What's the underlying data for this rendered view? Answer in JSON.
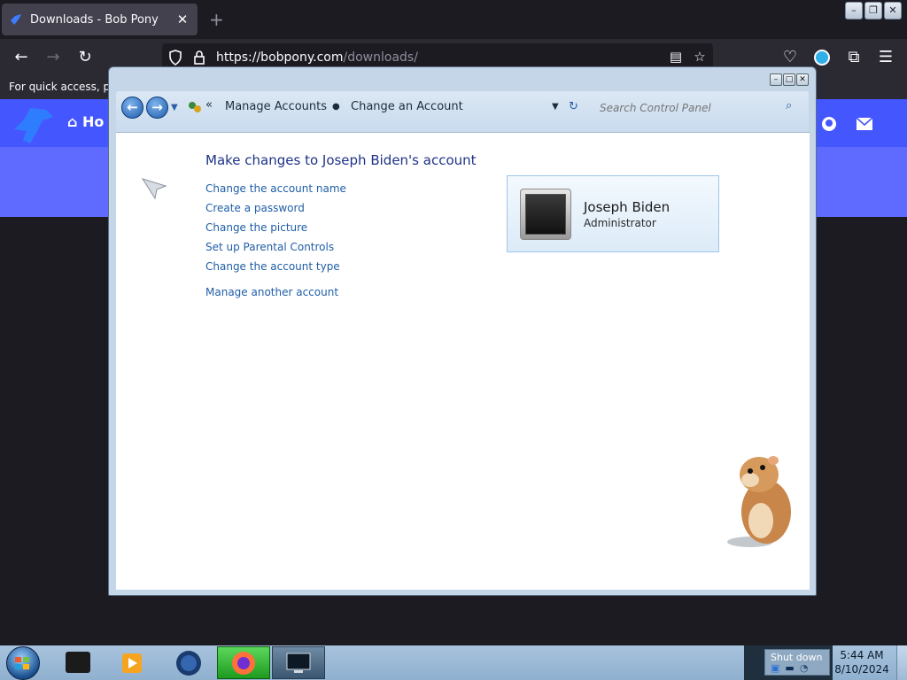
{
  "browser": {
    "tab_title": "Downloads - Bob Pony",
    "tab_close": "✕",
    "new_tab": "+",
    "url_host": "https://bobpony.com",
    "url_path": "/downloads/",
    "bookmarks_hint": "For quick access, plac"
  },
  "site": {
    "home_label": "Ho"
  },
  "control_panel": {
    "breadcrumb_1": "Manage Accounts",
    "breadcrumb_2": "Change an Account",
    "search_placeholder": "Search Control Panel",
    "heading": "Make changes to Joseph Biden's account",
    "links": [
      "Change the account name",
      "Create a password",
      "Change the picture",
      "Set up Parental Controls",
      "Change the account type",
      "Manage another account"
    ],
    "account": {
      "name": "Joseph Biden",
      "role": "Administrator"
    }
  },
  "taskbar": {
    "shutdown_label": "Shut down",
    "time": "5:44 AM",
    "date": "8/10/2024"
  },
  "colors": {
    "link": "#1f5ea8",
    "heading": "#1e3287",
    "site_header": "#4457ff"
  }
}
